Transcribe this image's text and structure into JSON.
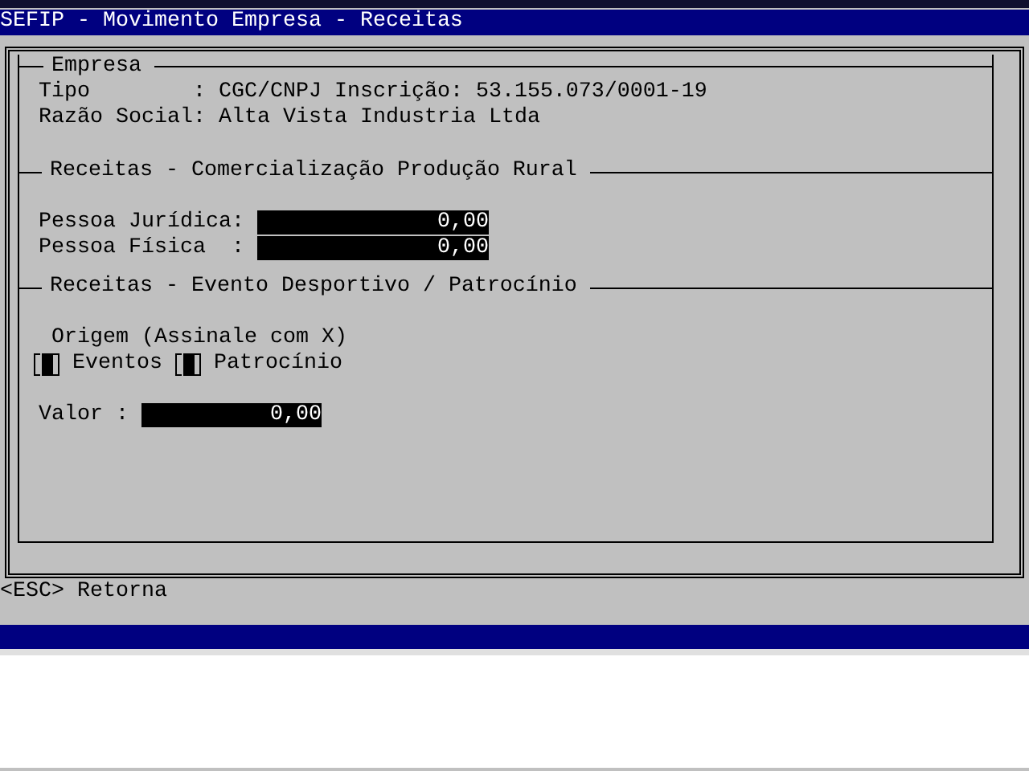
{
  "window": {
    "title": "SEFIP - Movimento Empresa - Receitas"
  },
  "sections": [
    {
      "title": "Empresa",
      "rows": [
        {
          "kind": "info",
          "label": "Tipo        :",
          "value": "CGC/CNPJ Inscrição: 53.155.073/0001-19"
        },
        {
          "kind": "info",
          "label": "Razão Social:",
          "value": "Alta Vista Industria Ltda"
        }
      ]
    },
    {
      "title": "Receitas - Comercialização Produção Rural",
      "rows": [
        {
          "kind": "field",
          "label": "Pessoa Jurídica:",
          "value": "0,00"
        },
        {
          "kind": "field",
          "label": "Pessoa Física  :",
          "value": "0,00"
        }
      ]
    },
    {
      "title": "Receitas - Evento Desportivo / Patrocínio",
      "rows": [
        {
          "kind": "note",
          "text": "Origem (Assinale com X)"
        },
        {
          "kind": "checks",
          "items": [
            {
              "label": "Eventos"
            },
            {
              "label": "Patrocínio"
            }
          ]
        },
        {
          "kind": "short-field",
          "label": "Valor :",
          "value": "0,00"
        }
      ]
    }
  ],
  "footer": {
    "hint": "<ESC> Retorna"
  }
}
